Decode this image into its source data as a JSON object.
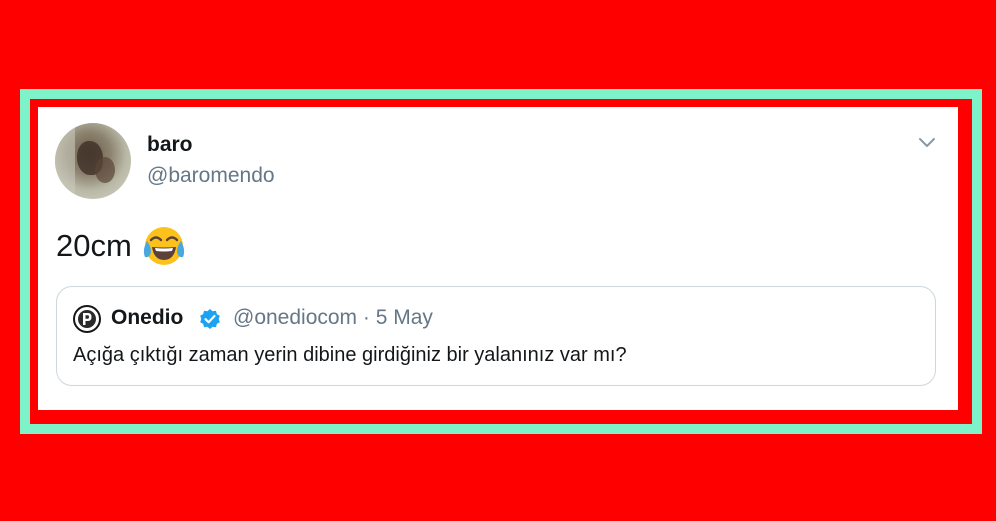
{
  "tweet": {
    "author": {
      "name": "baro",
      "handle": "@baromendo"
    },
    "text": "20cm",
    "emoji": "face-with-tears-of-joy-icon",
    "quoted": {
      "name": "Onedio",
      "handle": "@onediocom",
      "separator": "·",
      "date": "5 May",
      "text": "Açığa çıktığı zaman yerin dibine girdiğiniz bir yalanınız var mı?",
      "verified": true
    }
  },
  "colors": {
    "background": "#ff0000",
    "frame": "#7ef2c8",
    "card": "#ffffff",
    "text": "#14171a",
    "muted": "#657786",
    "verified": "#1da1f2",
    "border": "#ccd6dd"
  }
}
